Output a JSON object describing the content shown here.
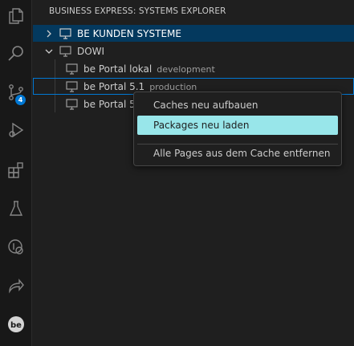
{
  "sidebar": {
    "title": "BUSINESS EXPRESS: SYSTEMS EXPLORER",
    "rows": [
      {
        "label": "BE KUNDEN SYSTEME",
        "description": ""
      },
      {
        "label": "DOWI",
        "description": ""
      },
      {
        "label": "be Portal lokal",
        "description": "development"
      },
      {
        "label": "be Portal 5.1",
        "description": "production"
      },
      {
        "label": "be Portal 5",
        "description": ""
      }
    ]
  },
  "activity_bar": {
    "scm_badge": "4",
    "icons": [
      "explorer-icon",
      "search-icon",
      "source-control-icon",
      "run-debug-icon",
      "extensions-icon",
      "testing-icon",
      "remote-explorer-icon",
      "live-share-icon",
      "business-express-icon"
    ]
  },
  "context_menu": {
    "items": [
      "Caches neu aufbauen",
      "Packages neu laden",
      "Alle Pages aus dem Cache entfernen"
    ],
    "active_item": "Packages neu laden"
  },
  "colors": {
    "selection": "#04395e",
    "focus_border": "#0078d4",
    "menu_highlight": "#98e6ea",
    "badge": "#0078d4"
  }
}
